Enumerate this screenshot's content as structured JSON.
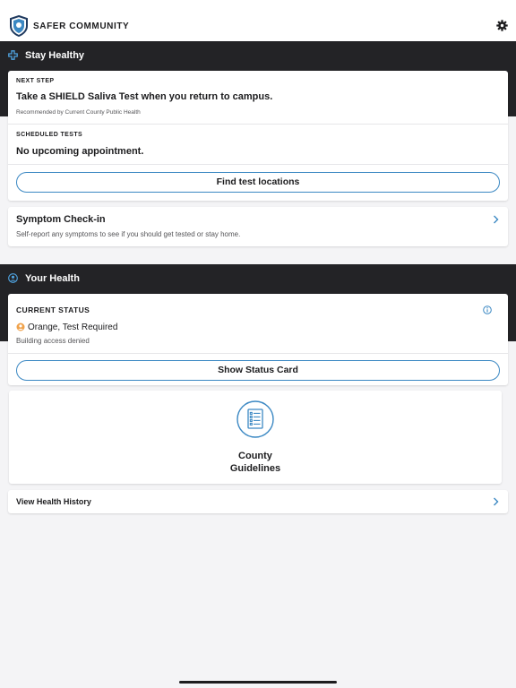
{
  "app": {
    "brand": "SAFER COMMUNITY"
  },
  "icons": {
    "logo": "shield-logo-icon",
    "settings": "gear-icon",
    "stay_healthy": "medical-cross-icon",
    "your_health": "person-icon",
    "status": "face-icon",
    "info": "info-icon",
    "chevron": "chevron-right-icon",
    "guidelines": "checklist-icon"
  },
  "colors": {
    "accent": "#3b88c3",
    "band": "#232326",
    "status_orange": "#f0a24b"
  },
  "stay_healthy": {
    "title": "Stay Healthy",
    "next_step": {
      "label": "NEXT STEP",
      "title": "Take a SHIELD Saliva Test when you return to campus.",
      "note": "Recommended by Current County Public Health"
    },
    "scheduled": {
      "label": "SCHEDULED TESTS",
      "title": "No upcoming appointment."
    },
    "find_button": "Find test locations",
    "checkin": {
      "title": "Symptom Check-in",
      "subtitle": "Self-report any symptoms to see if you should get tested or stay home."
    }
  },
  "your_health": {
    "title": "Your Health",
    "status": {
      "label": "CURRENT STATUS",
      "value": "Orange, Test Required",
      "note": "Building access denied"
    },
    "status_button": "Show Status Card",
    "guidelines": {
      "line1": "County",
      "line2": "Guidelines"
    },
    "history": "View Health History"
  }
}
